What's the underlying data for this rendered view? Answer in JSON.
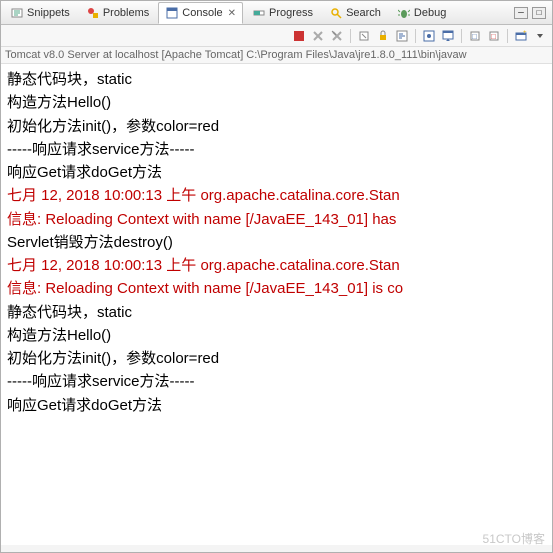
{
  "tabs": [
    {
      "label": "Snippets",
      "icon": "snippets"
    },
    {
      "label": "Problems",
      "icon": "problems"
    },
    {
      "label": "Console",
      "icon": "console",
      "active": true
    },
    {
      "label": "Progress",
      "icon": "progress"
    },
    {
      "label": "Search",
      "icon": "search"
    },
    {
      "label": "Debug",
      "icon": "debug"
    }
  ],
  "status": "Tomcat v8.0 Server at localhost [Apache Tomcat] C:\\Program Files\\Java\\jre1.8.0_111\\bin\\javaw",
  "console_lines": [
    {
      "text": "静态代码块，static",
      "red": false
    },
    {
      "text": "构造方法Hello()",
      "red": false
    },
    {
      "text": "初始化方法init()，参数color=red",
      "red": false
    },
    {
      "text": "-----响应请求service方法-----",
      "red": false
    },
    {
      "text": "响应Get请求doGet方法",
      "red": false
    },
    {
      "text": "七月 12, 2018 10:00:13 上午 org.apache.catalina.core.Stan",
      "red": true
    },
    {
      "text": "信息: Reloading Context with name [/JavaEE_143_01] has ",
      "red": true
    },
    {
      "text": "Servlet销毁方法destroy()",
      "red": false
    },
    {
      "text": "七月 12, 2018 10:00:13 上午 org.apache.catalina.core.Stan",
      "red": true
    },
    {
      "text": "信息: Reloading Context with name [/JavaEE_143_01] is co",
      "red": true
    },
    {
      "text": "静态代码块，static",
      "red": false
    },
    {
      "text": "构造方法Hello()",
      "red": false
    },
    {
      "text": "初始化方法init()，参数color=red",
      "red": false
    },
    {
      "text": "-----响应请求service方法-----",
      "red": false
    },
    {
      "text": "响应Get请求doGet方法",
      "red": false
    }
  ],
  "watermark": "51CTO博客"
}
